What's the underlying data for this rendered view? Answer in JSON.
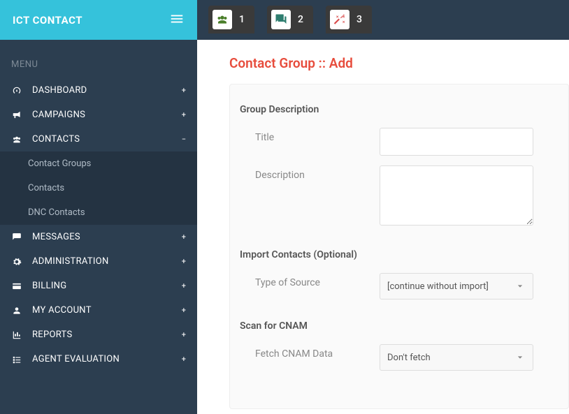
{
  "app": {
    "name": "ICT CONTACT"
  },
  "steps": [
    {
      "num": "1",
      "icon": "users",
      "color": "#4a7e2a"
    },
    {
      "num": "2",
      "icon": "chat",
      "color": "#2e7d6f"
    },
    {
      "num": "3",
      "icon": "wand",
      "color": "#d94a4a"
    }
  ],
  "sidebar": {
    "menu_label": "MENU",
    "items": [
      {
        "label": "DASHBOARD",
        "icon": "dashboard",
        "expand": "+"
      },
      {
        "label": "CAMPAIGNS",
        "icon": "bullhorn",
        "expand": "+"
      },
      {
        "label": "CONTACTS",
        "icon": "users",
        "expand": "−",
        "children": [
          {
            "label": "Contact Groups"
          },
          {
            "label": "Contacts"
          },
          {
            "label": "DNC Contacts"
          }
        ]
      },
      {
        "label": "MESSAGES",
        "icon": "comment",
        "expand": "+"
      },
      {
        "label": "ADMINISTRATION",
        "icon": "settings",
        "expand": "+"
      },
      {
        "label": "BILLING",
        "icon": "credit-card",
        "expand": "+"
      },
      {
        "label": "MY ACCOUNT",
        "icon": "user",
        "expand": "+"
      },
      {
        "label": "REPORTS",
        "icon": "chart",
        "expand": "+"
      },
      {
        "label": "AGENT EVALUATION",
        "icon": "list",
        "expand": "+"
      }
    ]
  },
  "page": {
    "title": "Contact Group :: Add",
    "sections": {
      "group_desc": {
        "heading": "Group Description",
        "title_label": "Title",
        "title_value": "",
        "desc_label": "Description",
        "desc_value": ""
      },
      "import": {
        "heading": "Import Contacts (Optional)",
        "type_label": "Type of Source",
        "type_value": "[continue without import]"
      },
      "cnam": {
        "heading": "Scan for CNAM",
        "fetch_label": "Fetch CNAM Data",
        "fetch_value": "Don't fetch"
      }
    }
  }
}
